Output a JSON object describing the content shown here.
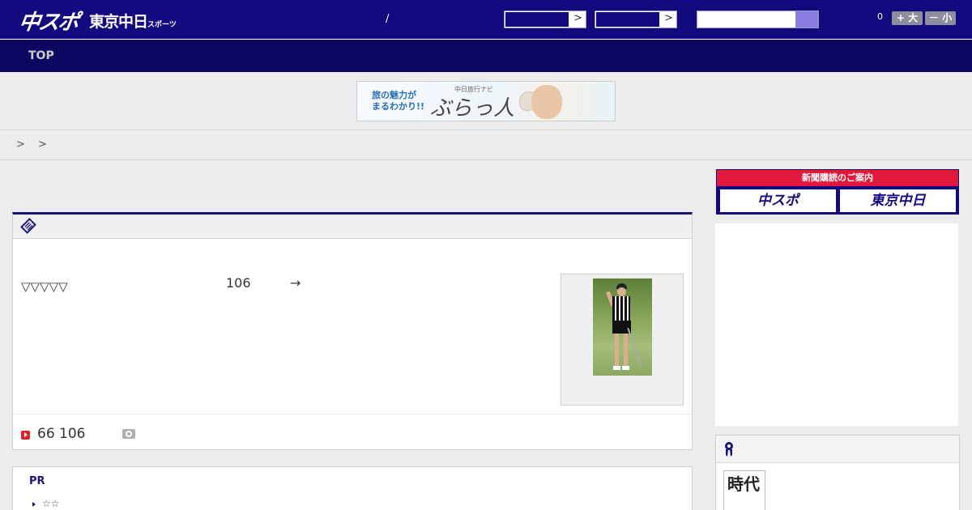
{
  "header": {
    "logo_main": "中スポ",
    "logo_sub": "東京中日",
    "logo_sub_small": "スポーツ",
    "slash": "/",
    "select1_arrow": ">",
    "select2_arrow": ">",
    "counter": "0",
    "font_larger_label": "+ 大",
    "font_smaller_label": "－ 小"
  },
  "nav": {
    "items": [
      {
        "label": "TOP"
      }
    ]
  },
  "banner": {
    "line1": "旅の魅力が",
    "line2": "まるわかり!!",
    "tagline": "中日旅行ナビ",
    "brand": "ぶらっ人"
  },
  "breadcrumb": {
    "text": "> >"
  },
  "article": {
    "lead": "▽▽▽▽▽",
    "number": "106",
    "arrow": "→",
    "footer_text": "66 106"
  },
  "pr": {
    "title": "PR",
    "items": [
      {
        "label": "☆☆"
      }
    ]
  },
  "sidebar": {
    "subscribe_title": "新聞購読のご案内",
    "subscribe_btn1": "中スポ",
    "subscribe_btn2": "東京中日",
    "jidai_text": "時代"
  },
  "colors": {
    "header_bg": "#140a80",
    "nav_bg": "#0c0660",
    "accent_red": "#e3193c",
    "search_btn": "#8a7fe0"
  }
}
